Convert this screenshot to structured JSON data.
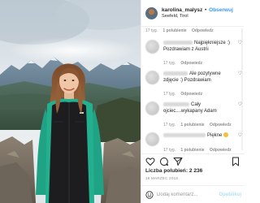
{
  "header": {
    "username": "karolina_malysz",
    "separator": "•",
    "follow_label": "Obserwuj",
    "location": "Seefeld, Tirol"
  },
  "comments": [
    {
      "meta_top": {
        "time": "17 tyg.",
        "likes": "1 polubienie",
        "reply": "Odpowiedz"
      },
      "text": "Najpiękniejsze :) Pozdrawiam z Austrii"
    },
    {
      "meta_top": {
        "time": "17 tyg.",
        "likes": "",
        "reply": "Odpowiedz"
      },
      "text": "Ale pozytywne zdjęcie :) Pozdrawiam"
    },
    {
      "meta_top": {
        "time": "17 tyg.",
        "likes": "",
        "reply": "Odpowiedz"
      },
      "text": "Cały ojciec....wykapany Adam"
    },
    {
      "meta_top": {
        "time": "17 tyg.",
        "likes": "1 polubienie",
        "reply": "Odpowiedz"
      },
      "text": "Piękne"
    }
  ],
  "last_meta": {
    "time": "17 tyg.",
    "likes": "1 polubienie",
    "reply": "Odpowiedz"
  },
  "actions": {
    "like_icon": "heart-icon",
    "comment_icon": "comment-icon",
    "share_icon": "share-icon",
    "save_icon": "bookmark-icon"
  },
  "likes_text": "Liczba polubień: 2 236",
  "date_text": "16 MARZEC 2018",
  "add_comment": {
    "placeholder": "Dodaj komentarz...",
    "publish_label": "Opublikuj"
  },
  "colors": {
    "accent": "#3897f0",
    "publish_disabled": "#b2dffc",
    "muted": "#8e8e8e"
  }
}
